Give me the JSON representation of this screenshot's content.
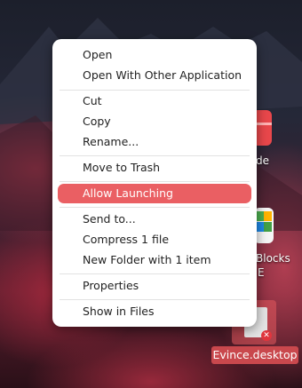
{
  "desktop": {
    "icons": {
      "partial_label_1": "de",
      "partial_label_2": "Blocks",
      "partial_label_3": "E",
      "evince_label": "Evince.desktop"
    }
  },
  "context_menu": {
    "items": [
      "Open",
      "Open With Other Application",
      "Cut",
      "Copy",
      "Rename...",
      "Move to Trash",
      "Allow Launching",
      "Send to...",
      "Compress 1 file",
      "New Folder with 1 item",
      "Properties",
      "Show in Files"
    ],
    "highlighted": "Allow Launching"
  },
  "colors": {
    "highlight": "#ea5f63",
    "menu_bg": "#ffffff"
  }
}
